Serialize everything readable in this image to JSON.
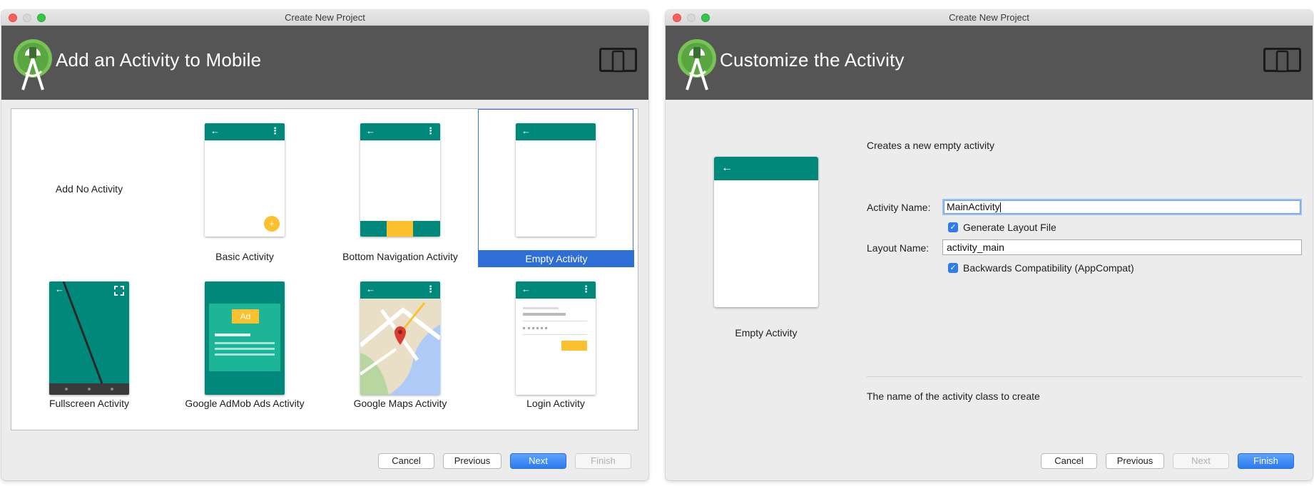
{
  "left_window": {
    "title": "Create New Project",
    "banner_title": "Add an Activity to Mobile",
    "gallery": {
      "no_activity_label": "Add No Activity",
      "items": [
        {
          "label": "Basic Activity"
        },
        {
          "label": "Bottom Navigation Activity"
        },
        {
          "label": "Empty Activity",
          "selected": true
        },
        {
          "label": "Fullscreen Activity"
        },
        {
          "label": "Google AdMob Ads Activity"
        },
        {
          "label": "Google Maps Activity"
        },
        {
          "label": "Login Activity"
        }
      ],
      "ad_badge": "Ad"
    },
    "buttons": {
      "cancel": "Cancel",
      "previous": "Previous",
      "next": "Next",
      "finish": "Finish"
    }
  },
  "right_window": {
    "title": "Create New Project",
    "banner_title": "Customize the Activity",
    "preview_caption": "Empty Activity",
    "description": "Creates a new empty activity",
    "form": {
      "activity_name_label": "Activity Name:",
      "activity_name_value": "MainActivity",
      "generate_layout_label": "Generate Layout File",
      "generate_layout_checked": true,
      "layout_name_label": "Layout Name:",
      "layout_name_value": "activity_main",
      "backwards_compat_label": "Backwards Compatibility (AppCompat)",
      "backwards_compat_checked": true
    },
    "help_text": "The name of the activity class to create",
    "buttons": {
      "cancel": "Cancel",
      "previous": "Previous",
      "next": "Next",
      "finish": "Finish"
    }
  },
  "colors": {
    "banner_bg": "#555555",
    "android_teal": "#00897b",
    "android_green": "#78c257",
    "selection_blue": "#2e6fd7",
    "accent_yellow": "#fbc02d",
    "window_bg": "#ececec"
  },
  "icons": [
    "android-studio-logo-icon",
    "device-icon",
    "back-arrow-icon",
    "overflow-menu-icon",
    "fab-add-icon",
    "fullscreen-icon",
    "map-pin-icon",
    "checkbox-icon"
  ]
}
